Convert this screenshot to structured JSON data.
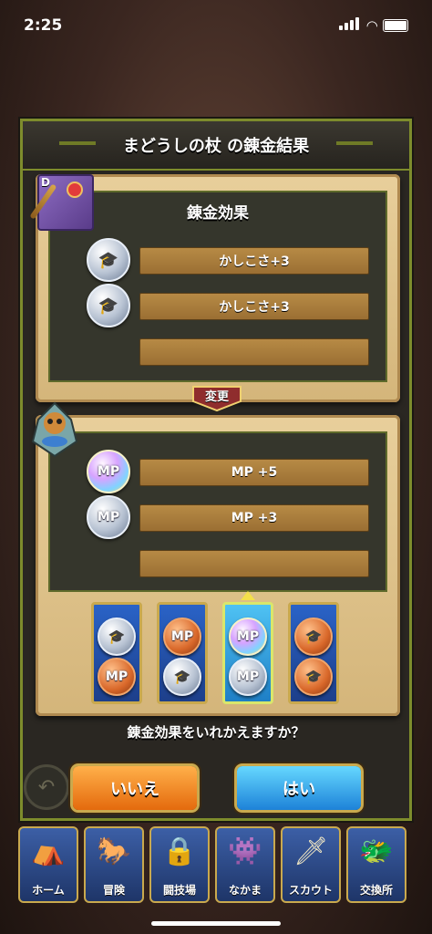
{
  "status_bar": {
    "time": "2:25"
  },
  "dialog": {
    "title": "まどうしの杖 の錬金結果",
    "item_rank": "D",
    "current_panel": {
      "header": "錬金効果",
      "rows": [
        {
          "coin": "silver",
          "icon": "hat-icon",
          "label": "かしこさ+3"
        },
        {
          "coin": "silver",
          "icon": "hat-icon",
          "label": "かしこさ+3"
        },
        {
          "coin": "",
          "icon": "",
          "label": ""
        }
      ]
    },
    "change_label": "変更",
    "new_panel": {
      "rows": [
        {
          "coin": "rainbow",
          "icon": "mp-icon",
          "icon_text": "MP",
          "label": "MP +5"
        },
        {
          "coin": "silver",
          "icon": "mp-icon",
          "icon_text": "MP",
          "label": "MP +3"
        },
        {
          "coin": "",
          "icon": "",
          "label": ""
        }
      ]
    },
    "cards": [
      {
        "selected": false,
        "top": {
          "coin": "silver",
          "icon": "hat-icon"
        },
        "bottom": {
          "coin": "bronze",
          "icon": "mp-icon",
          "text": "MP"
        }
      },
      {
        "selected": false,
        "top": {
          "coin": "bronze",
          "icon": "mp-icon",
          "text": "MP"
        },
        "bottom": {
          "coin": "silver",
          "icon": "hat-icon"
        }
      },
      {
        "selected": true,
        "top": {
          "coin": "rainbow",
          "icon": "mp-icon",
          "text": "MP"
        },
        "bottom": {
          "coin": "silver",
          "icon": "mp-icon",
          "text": "MP"
        }
      },
      {
        "selected": false,
        "top": {
          "coin": "bronze",
          "icon": "hat-icon"
        },
        "bottom": {
          "coin": "bronze",
          "icon": "hat-icon"
        }
      }
    ],
    "question": "錬金効果をいれかえますか？",
    "no_label": "いいえ",
    "yes_label": "はい"
  },
  "nav": [
    {
      "label": "ホーム",
      "icon": "tent-icon",
      "locked": false
    },
    {
      "label": "冒険",
      "icon": "wagon-icon",
      "locked": false
    },
    {
      "label": "闘技場",
      "icon": "lock-icon",
      "locked": true
    },
    {
      "label": "なかま",
      "icon": "monsters-icon",
      "locked": false
    },
    {
      "label": "スカウト",
      "icon": "scout-icon",
      "locked": false
    },
    {
      "label": "交換所",
      "icon": "exchange-icon",
      "locked": false
    }
  ]
}
